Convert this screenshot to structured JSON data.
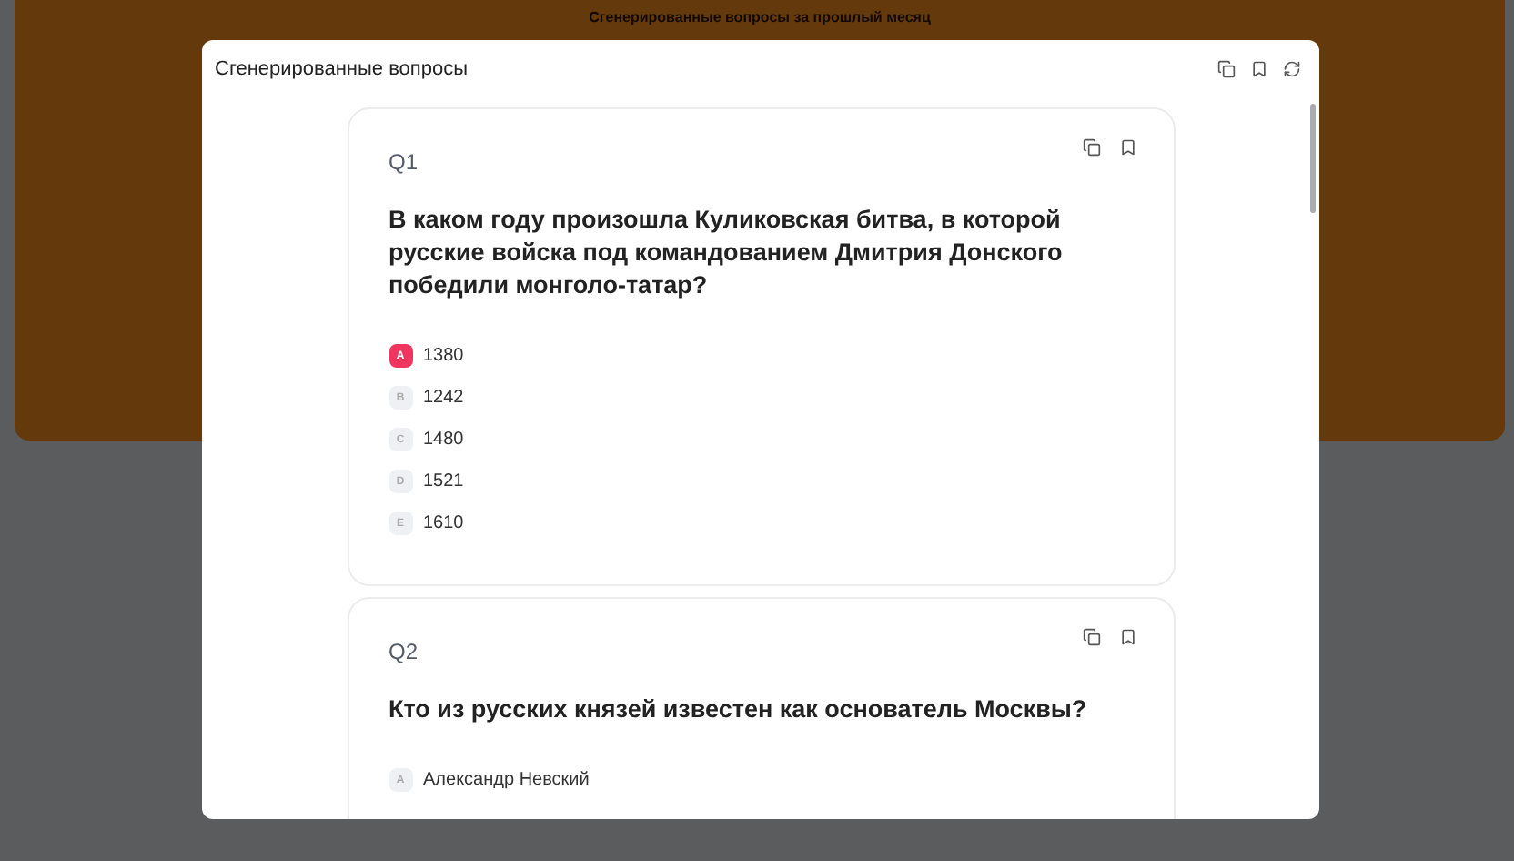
{
  "background": {
    "title": "Сгенерированные вопросы за прошлый месяц"
  },
  "modal": {
    "title": "Сгенерированные вопросы"
  },
  "questions": [
    {
      "number": "Q1",
      "text": "В каком году произошла Куликовская битва, в которой русские войска под командованием Дмитрия Донского победили монголо-татар?",
      "options": [
        {
          "letter": "A",
          "text": "1380",
          "selected": true
        },
        {
          "letter": "B",
          "text": "1242",
          "selected": false
        },
        {
          "letter": "C",
          "text": "1480",
          "selected": false
        },
        {
          "letter": "D",
          "text": "1521",
          "selected": false
        },
        {
          "letter": "E",
          "text": "1610",
          "selected": false
        }
      ]
    },
    {
      "number": "Q2",
      "text": "Кто из русских князей известен как основатель Москвы?",
      "options": [
        {
          "letter": "A",
          "text": "Александр Невский",
          "selected": false
        }
      ]
    }
  ]
}
